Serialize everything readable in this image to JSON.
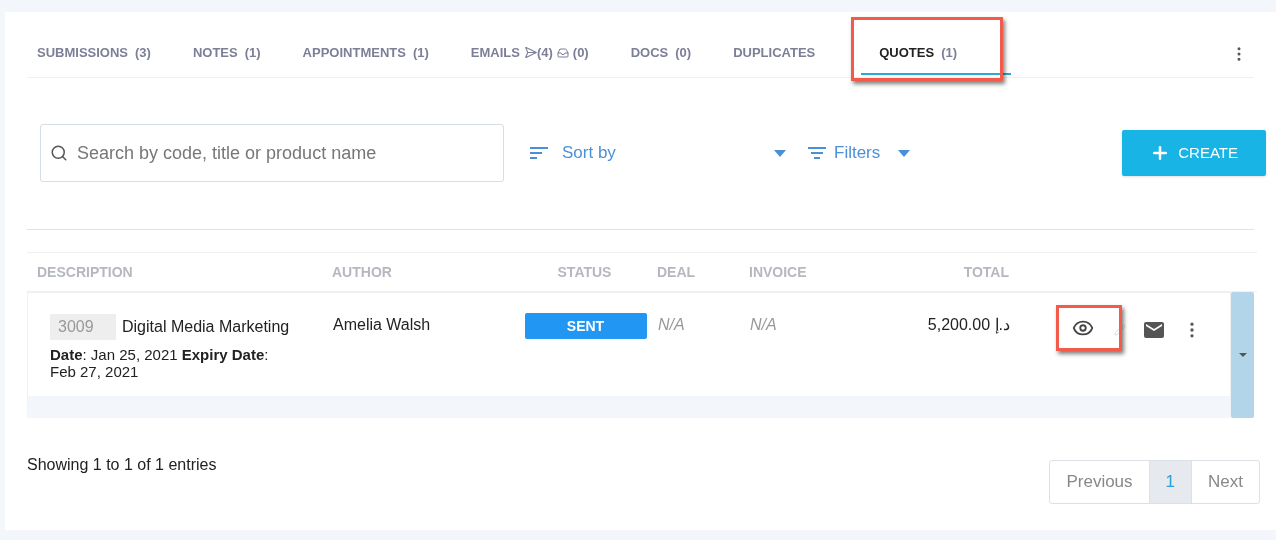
{
  "tabs": [
    {
      "kind": "plain",
      "label": "SUBMISSIONS",
      "count": "(3)",
      "selected": false,
      "highlighted": false
    },
    {
      "kind": "plain",
      "label": "NOTES",
      "count": "(1)",
      "selected": false,
      "highlighted": false
    },
    {
      "kind": "plain",
      "label": "APPOINTMENTS",
      "count": "(1)",
      "selected": false,
      "highlighted": false
    },
    {
      "kind": "emails",
      "label": "EMAILS",
      "sent_count": "(4)",
      "inbox_count": "(0)",
      "selected": false,
      "highlighted": false
    },
    {
      "kind": "plain",
      "label": "DOCS",
      "count": "(0)",
      "selected": false,
      "highlighted": false
    },
    {
      "kind": "plain",
      "label": "DUPLICATES",
      "selected": false,
      "highlighted": false
    },
    {
      "kind": "plain",
      "label": "QUOTES",
      "count": "(1)",
      "selected": true,
      "highlighted": true
    }
  ],
  "search": {
    "placeholder": "Search by code, title or product name"
  },
  "sort": {
    "label": "Sort by"
  },
  "filters": {
    "label": "Filters"
  },
  "create_button": {
    "label": "CREATE"
  },
  "table": {
    "columns": [
      "DESCRIPTION",
      "AUTHOR",
      "STATUS",
      "DEAL",
      "INVOICE",
      "TOTAL"
    ],
    "rows": [
      {
        "code": "3009",
        "title": "Digital Media Marketing",
        "dates": "**Date**: Jan 25, 2021  **Expiry Date**: Feb 27, 2021",
        "author": "Amelia Walsh",
        "status": "SENT",
        "deal": "N/A",
        "invoice": "N/A",
        "total": "5,200.00 د.إ",
        "view_highlighted": true
      }
    ]
  },
  "footer": {
    "info": "Showing 1 to 1 of 1 entries",
    "pages": [
      {
        "label": "Previous",
        "selected": false
      },
      {
        "label": "1",
        "selected": true
      },
      {
        "label": "Next",
        "selected": false
      }
    ]
  }
}
